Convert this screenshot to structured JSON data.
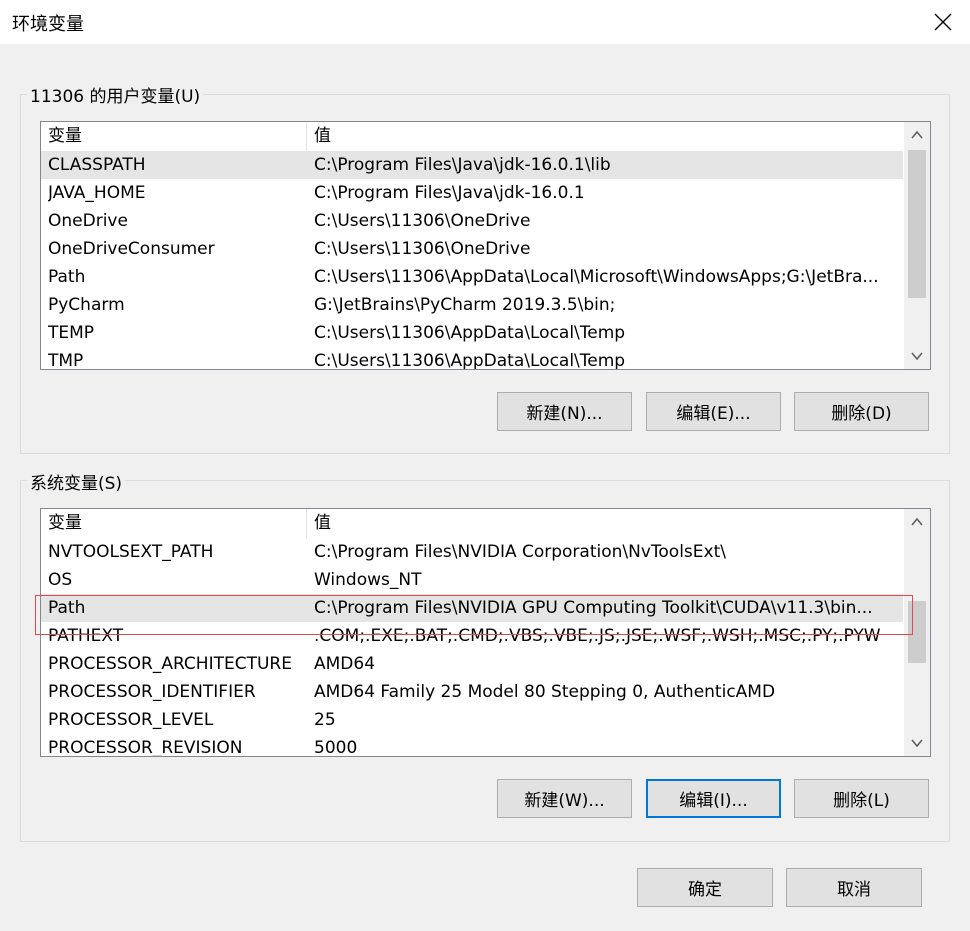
{
  "window": {
    "title": "环境变量"
  },
  "user_vars": {
    "legend": "11306 的用户变量(U)",
    "col_var": "变量",
    "col_val": "值",
    "rows": [
      {
        "name": "CLASSPATH",
        "value": "C:\\Program Files\\Java\\jdk-16.0.1\\lib"
      },
      {
        "name": "JAVA_HOME",
        "value": "C:\\Program Files\\Java\\jdk-16.0.1"
      },
      {
        "name": "OneDrive",
        "value": "C:\\Users\\11306\\OneDrive"
      },
      {
        "name": "OneDriveConsumer",
        "value": "C:\\Users\\11306\\OneDrive"
      },
      {
        "name": "Path",
        "value": "C:\\Users\\11306\\AppData\\Local\\Microsoft\\WindowsApps;G:\\JetBra..."
      },
      {
        "name": "PyCharm",
        "value": "G:\\JetBrains\\PyCharm 2019.3.5\\bin;"
      },
      {
        "name": "TEMP",
        "value": "C:\\Users\\11306\\AppData\\Local\\Temp"
      },
      {
        "name": "TMP",
        "value": "C:\\Users\\11306\\AppData\\Local\\Temp"
      }
    ],
    "buttons": {
      "new": "新建(N)...",
      "edit": "编辑(E)...",
      "delete": "删除(D)"
    }
  },
  "system_vars": {
    "legend": "系统变量(S)",
    "col_var": "变量",
    "col_val": "值",
    "rows": [
      {
        "name": "NVTOOLSEXT_PATH",
        "value": "C:\\Program Files\\NVIDIA Corporation\\NvToolsExt\\"
      },
      {
        "name": "OS",
        "value": "Windows_NT"
      },
      {
        "name": "Path",
        "value": "C:\\Program Files\\NVIDIA GPU Computing Toolkit\\CUDA\\v11.3\\bin..."
      },
      {
        "name": "PATHEXT",
        "value": ".COM;.EXE;.BAT;.CMD;.VBS;.VBE;.JS;.JSE;.WSF;.WSH;.MSC;.PY;.PYW"
      },
      {
        "name": "PROCESSOR_ARCHITECTURE",
        "value": "AMD64"
      },
      {
        "name": "PROCESSOR_IDENTIFIER",
        "value": "AMD64 Family 25 Model 80 Stepping 0, AuthenticAMD"
      },
      {
        "name": "PROCESSOR_LEVEL",
        "value": "25"
      },
      {
        "name": "PROCESSOR_REVISION",
        "value": "5000"
      }
    ],
    "buttons": {
      "new": "新建(W)...",
      "edit": "编辑(I)...",
      "delete": "删除(L)"
    }
  },
  "footer": {
    "ok": "确定",
    "cancel": "取消"
  },
  "icons": {
    "close": "close-icon",
    "up": "chevron-up-icon",
    "down": "chevron-down-icon"
  }
}
